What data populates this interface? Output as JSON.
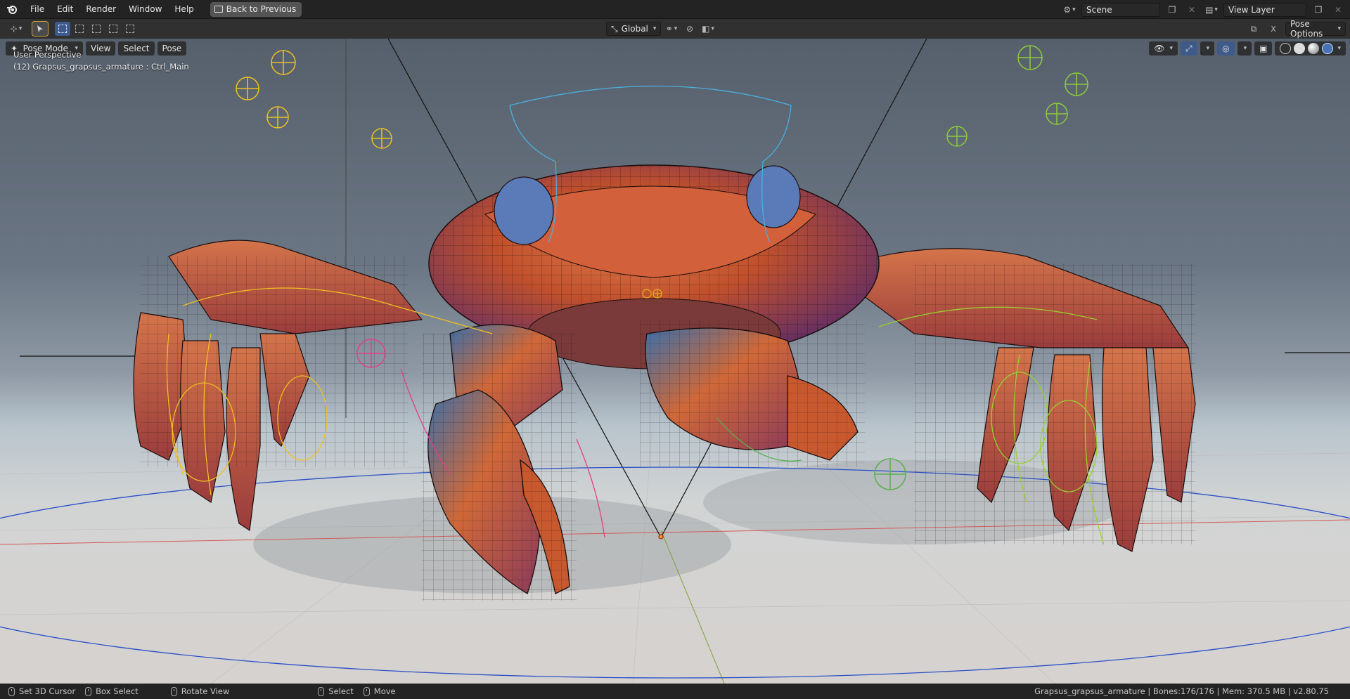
{
  "app": {
    "menu": [
      "File",
      "Edit",
      "Render",
      "Window",
      "Help"
    ],
    "back_button": "Back to Previous",
    "scene": "Scene",
    "view_layer": "View Layer"
  },
  "header": {
    "transform_orientation": "Global",
    "pose_options": "Pose Options"
  },
  "viewport": {
    "mode": "Pose Mode",
    "menus": [
      "View",
      "Select",
      "Pose"
    ],
    "perspective": "User Perspective",
    "active": "(12) Grapsus_grapsus_armature : Ctrl_Main"
  },
  "status": {
    "hints": [
      "Set 3D Cursor",
      "Box Select",
      "Rotate View",
      "Select",
      "Move"
    ],
    "right": "Grapsus_grapsus_armature | Bones:176/176  | Mem: 370.5 MB | v2.80.75"
  },
  "colors": {
    "accent": "#4772b3",
    "active_tool": "#c8a03a",
    "shell": "#c8582e"
  }
}
